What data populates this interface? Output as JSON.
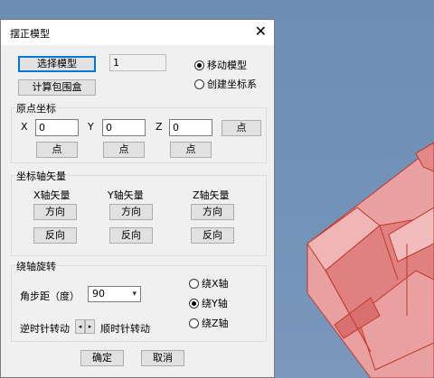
{
  "dialog": {
    "title": "摆正模型",
    "close_glyph": "✕",
    "select_model_label": "选择模型",
    "model_count": "1",
    "compute_bbox_label": "计算包围盒",
    "mode_options": [
      "移动模型",
      "创建坐标系"
    ],
    "mode_selected": 0
  },
  "origin": {
    "group_title": "原点坐标",
    "x_label": "X",
    "y_label": "Y",
    "z_label": "Z",
    "x_value": "0",
    "y_value": "0",
    "z_value": "0",
    "point_label": "点"
  },
  "axis_vector": {
    "group_title": "坐标轴矢量",
    "columns": [
      "X轴矢量",
      "Y轴矢量",
      "Z轴矢量"
    ],
    "direction_label": "方向",
    "reverse_label": "反向"
  },
  "rotation": {
    "group_title": "绕轴旋转",
    "step_label": "角步距（度）",
    "step_value": "90",
    "ccw_label": "逆时针转动",
    "cw_label": "顺时针转动",
    "spin_left": "◂",
    "spin_right": "▸",
    "axis_options": [
      "绕X轴",
      "绕Y轴",
      "绕Z轴"
    ],
    "axis_selected": 1
  },
  "footer": {
    "ok_label": "确定",
    "cancel_label": "取消"
  },
  "colors": {
    "model_fill": "#e88b8b",
    "model_edge": "#c0392b",
    "accent": "#0078d7"
  }
}
